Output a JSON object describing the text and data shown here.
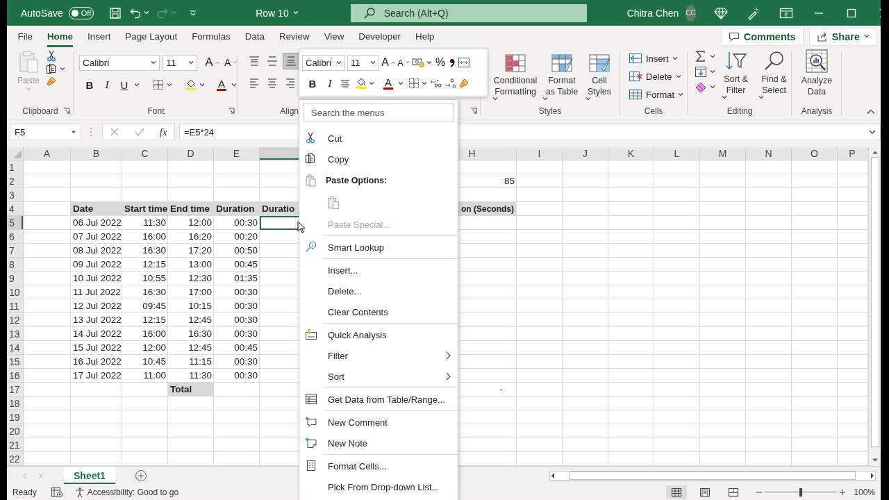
{
  "title_bar": {
    "autosave_label": "AutoSave",
    "autosave_text": "Off",
    "autosave_on": false,
    "redo_disabled": true,
    "document_title": "Row 10",
    "search_placeholder": "Search (Alt+Q)",
    "user_name": "Chitra Chen",
    "user_initials": "CC"
  },
  "tabs": [
    {
      "label": "File",
      "selected": false
    },
    {
      "label": "Home",
      "selected": true
    },
    {
      "label": "Insert",
      "selected": false
    },
    {
      "label": "Page Layout",
      "selected": false
    },
    {
      "label": "Formulas",
      "selected": false
    },
    {
      "label": "Data",
      "selected": false
    },
    {
      "label": "Review",
      "selected": false
    },
    {
      "label": "View",
      "selected": false
    },
    {
      "label": "Developer",
      "selected": false
    },
    {
      "label": "Help",
      "selected": false
    }
  ],
  "comments_button": "Comments",
  "share_button": "Share",
  "ribbon": {
    "clipboard": {
      "label": "Clipboard",
      "paste": "Paste",
      "paste_disabled": true
    },
    "font": {
      "label": "Font",
      "font_name": "Calibri",
      "font_size": "11",
      "grow": "A",
      "shrink": "A",
      "styles": [
        "B",
        "I",
        "U"
      ],
      "font_color": "A"
    },
    "alignment": {
      "label": "Align",
      "buttons": [
        {
          "selected": false
        },
        {
          "selected": false
        },
        {
          "selected": true
        },
        {
          "selected": false
        },
        {
          "selected": false
        },
        {
          "selected": false
        }
      ]
    },
    "styles": {
      "label": "Styles",
      "buttons": [
        "Conditional Formatting",
        "Format as Table",
        "Cell Styles"
      ]
    },
    "cells": {
      "label": "Cells",
      "buttons": [
        "Insert",
        "Delete",
        "Format"
      ]
    },
    "editing": {
      "label": "Editing",
      "buttons": [
        "Sort & Filter",
        "Find & Select"
      ]
    },
    "analysis": {
      "label": "Analysis",
      "buttons": [
        "Analyze Data"
      ]
    }
  },
  "mini_toolbar": {
    "font_name": "Calibri",
    "font_size": "11",
    "grow": "A",
    "shrink": "A",
    "percent": "%",
    "styles": [
      "B",
      "I"
    ],
    "font_color": "A"
  },
  "formula_bar": {
    "name_box": "F5",
    "function_label": "fx",
    "formula": "=E5*24"
  },
  "sheet": {
    "columns": [
      {
        "label": "A",
        "selected": false
      },
      {
        "label": "B",
        "selected": false
      },
      {
        "label": "C",
        "selected": false
      },
      {
        "label": "D",
        "selected": false
      },
      {
        "label": "E",
        "selected": false
      },
      {
        "selected": true
      },
      {},
      {
        "label": "H",
        "selected": false
      },
      {
        "label": "I",
        "selected": false
      },
      {
        "label": "J",
        "selected": false
      },
      {
        "label": "K",
        "selected": false
      },
      {
        "label": "L",
        "selected": false
      },
      {
        "label": "M",
        "selected": false
      },
      {
        "label": "N",
        "selected": false
      },
      {
        "label": "O",
        "selected": false
      },
      {
        "label": "P",
        "selected": false
      }
    ],
    "rows": [
      {
        "label": "1",
        "selected": false
      },
      {
        "label": "2",
        "selected": false
      },
      {
        "label": "3",
        "selected": false
      },
      {
        "label": "4",
        "selected": false
      },
      {
        "label": "5",
        "selected": true
      },
      {
        "label": "6",
        "selected": false
      },
      {
        "label": "7",
        "selected": false
      },
      {
        "label": "8",
        "selected": false
      },
      {
        "label": "9",
        "selected": false
      },
      {
        "label": "10",
        "selected": false
      },
      {
        "label": "11",
        "selected": false
      },
      {
        "label": "12",
        "selected": false
      },
      {
        "label": "13",
        "selected": false
      },
      {
        "label": "14",
        "selected": false
      },
      {
        "label": "15",
        "selected": false
      },
      {
        "label": "16",
        "selected": false
      },
      {
        "label": "17",
        "selected": false
      },
      {
        "label": "18",
        "selected": false
      },
      {
        "label": "19",
        "selected": false
      },
      {
        "label": "20",
        "selected": false
      },
      {
        "label": "21",
        "selected": false
      },
      {
        "label": "22",
        "selected": false
      }
    ],
    "summary_value": "85",
    "table": {
      "headers": [
        "Date",
        "Start time",
        "End time",
        "Duration",
        "Duratio"
      ],
      "side_header": "on (Seconds)",
      "rows": [
        [
          "06 Jul 2022",
          "11:30",
          "12:00",
          "00:30"
        ],
        [
          "07 Jul 2022",
          "16:00",
          "16:20",
          "00:20"
        ],
        [
          "08 Jul 2022",
          "16:30",
          "17:20",
          "00:50"
        ],
        [
          "09 Jul 2022",
          "12:15",
          "13:00",
          "00:45"
        ],
        [
          "10 Jul 2022",
          "10:55",
          "12:30",
          "01:35"
        ],
        [
          "11 Jul 2022",
          "16:30",
          "17:00",
          "00:30"
        ],
        [
          "12 Jul 2022",
          "09:45",
          "10:15",
          "00:30"
        ],
        [
          "13 Jul 2022",
          "12:15",
          "12:45",
          "00:30"
        ],
        [
          "14 Jul 2022",
          "16:00",
          "16:30",
          "00:30"
        ],
        [
          "15 Jul 2022",
          "12:00",
          "12:45",
          "00:45"
        ],
        [
          "16 Jul 2022",
          "10:45",
          "11:15",
          "00:30"
        ],
        [
          "17 Jul 2022",
          "11:00",
          "11:30",
          "00:30"
        ]
      ],
      "total_label": "Total",
      "total_value": "-"
    }
  },
  "context_menu": {
    "search_placeholder": "Search the menus",
    "items": [
      {
        "kind": "command",
        "label": "Cut",
        "disabled": false,
        "submenu": false
      },
      {
        "kind": "command",
        "label": "Copy",
        "disabled": false,
        "submenu": false
      },
      {
        "kind": "heading",
        "label": "Paste Options:"
      },
      {
        "kind": "paste-options"
      },
      {
        "kind": "command",
        "label": "Paste Special...",
        "disabled": true,
        "submenu": false
      },
      {
        "kind": "separator"
      },
      {
        "kind": "command",
        "label": "Smart Lookup",
        "disabled": false,
        "submenu": false
      },
      {
        "kind": "separator"
      },
      {
        "kind": "command",
        "label": "Insert...",
        "disabled": false,
        "submenu": false
      },
      {
        "kind": "command",
        "label": "Delete...",
        "disabled": false,
        "submenu": false
      },
      {
        "kind": "command",
        "label": "Clear Contents",
        "disabled": false,
        "submenu": false
      },
      {
        "kind": "separator"
      },
      {
        "kind": "command",
        "label": "Quick Analysis",
        "disabled": false,
        "submenu": false
      },
      {
        "kind": "command",
        "label": "Filter",
        "disabled": false,
        "submenu": true
      },
      {
        "kind": "command",
        "label": "Sort",
        "disabled": false,
        "submenu": true
      },
      {
        "kind": "separator"
      },
      {
        "kind": "command",
        "label": "Get Data from Table/Range...",
        "disabled": false,
        "submenu": false
      },
      {
        "kind": "separator"
      },
      {
        "kind": "command",
        "label": "New Comment",
        "disabled": false,
        "submenu": false
      },
      {
        "kind": "command",
        "label": "New Note",
        "disabled": false,
        "submenu": false
      },
      {
        "kind": "separator"
      },
      {
        "kind": "command",
        "label": "Format Cells...",
        "disabled": false,
        "submenu": false
      },
      {
        "kind": "command",
        "label": "Pick From Drop-down List...",
        "disabled": false,
        "submenu": false
      }
    ]
  },
  "sheet_tabs": [
    {
      "label": "Sheet1",
      "selected": true
    }
  ],
  "status_bar": {
    "mode": "Ready",
    "accessibility": "Accessibility: Good to go",
    "views": [
      {
        "selected": true
      },
      {
        "selected": false
      },
      {
        "selected": false
      }
    ],
    "zoom": {
      "level": 0.5,
      "label": "100%"
    }
  }
}
